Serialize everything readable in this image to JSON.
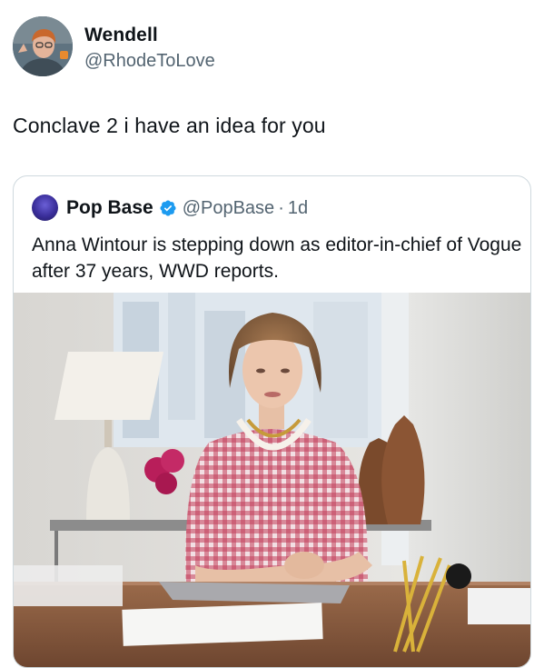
{
  "author": {
    "name": "Wendell",
    "handle": "@RhodeToLove",
    "avatar_icon": "profile-photo"
  },
  "tweet": {
    "text": "Conclave 2 i have an idea for you"
  },
  "quoted_tweet": {
    "author_name": "Pop Base",
    "verified_icon": "verified-badge-icon",
    "verified_color": "#1d9bf0",
    "handle": "@PopBase",
    "separator": "·",
    "time": "1d",
    "text": "Anna Wintour is stepping down as editor-in-chief of Vogue after 37 years, WWD reports.",
    "image_icon": "photo-woman-at-desk"
  }
}
